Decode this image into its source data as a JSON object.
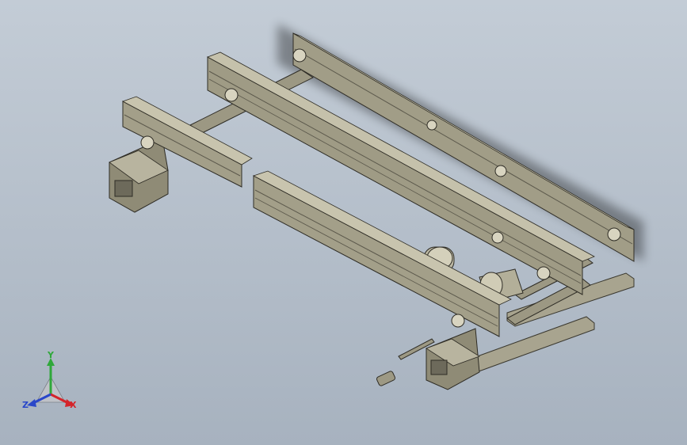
{
  "viewport": {
    "background_top": "#c3ccd6",
    "background_bottom": "#a7b2bf",
    "part_color": "#9a9682",
    "part_dark": "#6e6b5c",
    "part_light": "#bdb9a4"
  },
  "triad": {
    "x_label": "X",
    "y_label": "Y",
    "z_label": "Z",
    "x_color": "#d4242a",
    "y_color": "#2fa83a",
    "z_color": "#2a47c9"
  }
}
